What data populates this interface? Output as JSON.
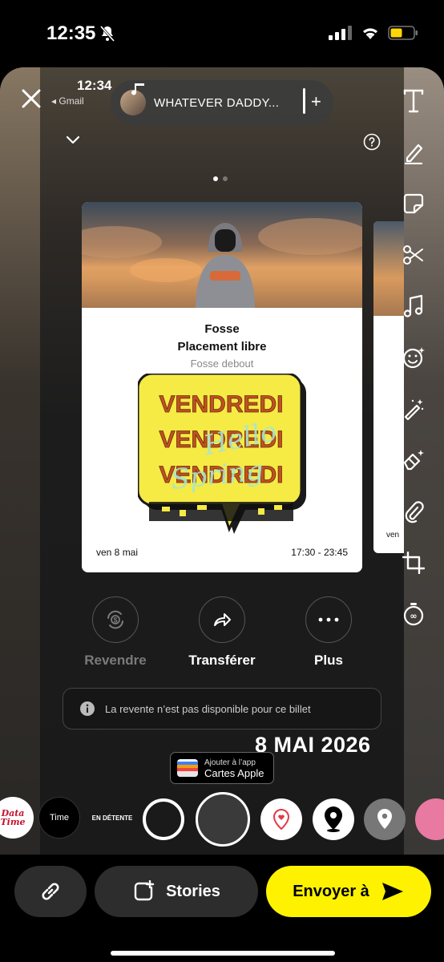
{
  "status_bar": {
    "time": "12:35"
  },
  "editor": {
    "inner_time": "12:34",
    "back_app": "◂ Gmail",
    "music": {
      "title": "WHATEVER DADDY..."
    }
  },
  "ticket": {
    "category": "Fosse",
    "placement": "Placement libre",
    "subtitle": "Fosse debout",
    "date": "ven 8 mai",
    "hours": "17:30 - 23:45",
    "sticker_words": [
      "VENDREDI",
      "VENDREDI",
      "VENDREDI"
    ],
    "sticker_overlay": [
      "Hello",
      "Spring"
    ],
    "peek_date": "ven"
  },
  "actions": [
    {
      "label": "Revendre",
      "icon": "resell-icon",
      "disabled": true
    },
    {
      "label": "Transférer",
      "icon": "share-arrow-icon",
      "disabled": false
    },
    {
      "label": "Plus",
      "icon": "more-icon",
      "disabled": false
    }
  ],
  "info": {
    "text": "La revente n’est pas disponible pour ce billet"
  },
  "date_sticker": "8 MAI 2026",
  "apple_wallet": {
    "line1": "Ajouter à l’app",
    "line2": "Cartes Apple"
  },
  "lenses": [
    {
      "name": "data-time-lens",
      "text": "Data Time"
    },
    {
      "name": "time-lens",
      "text": "Time"
    },
    {
      "name": "en-detente-lens",
      "text": "EN DÉTENTE"
    }
  ],
  "bottom_bar": {
    "stories_label": "Stories",
    "send_label": "Envoyer à"
  },
  "colors": {
    "snap_yellow": "#fef200",
    "sticker_yellow": "#f6ea45",
    "sticker_text": "#c0521f",
    "overlay_mint": "#a8e6cf"
  }
}
